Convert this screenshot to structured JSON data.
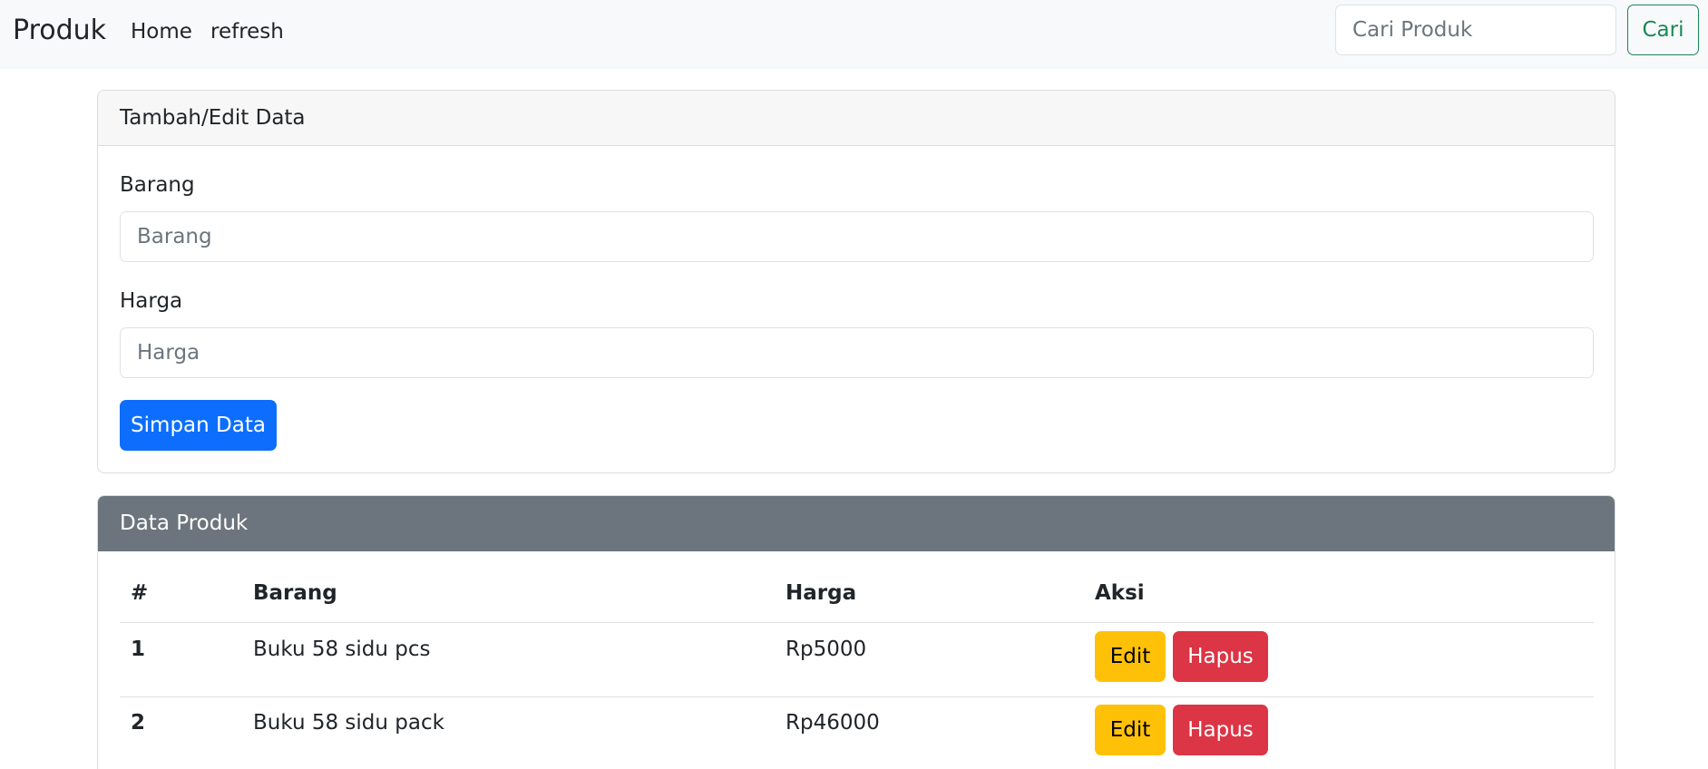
{
  "navbar": {
    "brand": "Produk",
    "links": [
      "Home",
      "refresh"
    ],
    "search": {
      "placeholder": "Cari Produk",
      "value": ""
    },
    "search_button": "Cari"
  },
  "form_card": {
    "title": "Tambah/Edit Data",
    "barang_label": "Barang",
    "barang_placeholder": "Barang",
    "harga_label": "Harga",
    "harga_placeholder": "Harga",
    "save_button": "Simpan Data"
  },
  "table_card": {
    "title": "Data Produk",
    "columns": [
      "#",
      "Barang",
      "Harga",
      "Aksi"
    ],
    "rows": [
      {
        "no": "1",
        "barang": "Buku 58 sidu pcs",
        "harga": "Rp5000",
        "edit": "Edit",
        "hapus": "Hapus"
      },
      {
        "no": "2",
        "barang": "Buku 58 sidu pack",
        "harga": "Rp46000",
        "edit": "Edit",
        "hapus": "Hapus"
      }
    ]
  },
  "colors": {
    "primary": "#0d6efd",
    "success": "#198754",
    "warning": "#ffc107",
    "danger": "#dc3545",
    "secondary": "#6c757d"
  }
}
